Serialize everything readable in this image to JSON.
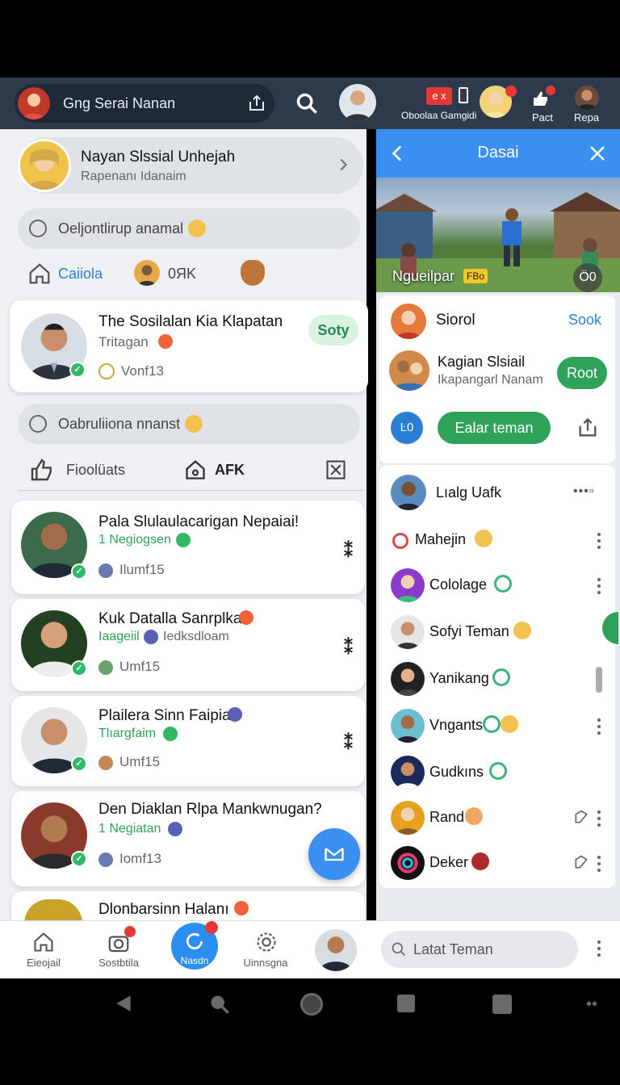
{
  "topbar": {
    "search_text": "Gng Serai Nanan",
    "group_label": "Oboolaa Gamgidi",
    "pact_label": "Pact",
    "repa_label": "Repa",
    "ex_badge": "e x"
  },
  "profile": {
    "name": "Nayan Slssial Unhejah",
    "sub": "Rapenanı Idanaim"
  },
  "composer1": {
    "placeholder": "Oeljontlirup anamal"
  },
  "quick": {
    "item1": "Caiiola",
    "item2": "0ЯK"
  },
  "featured": {
    "title": "The Sosilalan Kia Klapatan",
    "sub": "Tritagan",
    "meta": "Vonf13",
    "button": "Soty"
  },
  "composer2": {
    "placeholder": "Oabruliiona nnanst"
  },
  "actions": {
    "item1": "Fioolüats",
    "item2": "AFK"
  },
  "posts": [
    {
      "title": "Pala Slulaulacarigan Nepaiai!",
      "tag": "1 Negiogsen",
      "meta": "Ilumf15"
    },
    {
      "title": "Kuk Datalla Sanrplkan",
      "tag": "Iaageiil",
      "tag2": "Iedksdloam",
      "meta": "Umf15"
    },
    {
      "title": "Plailera Sinn Faipiaı",
      "tag": "Tlıargfaim",
      "meta": "Umf15"
    },
    {
      "title": "Den Diaklan Rlpa Mankwnugan?",
      "tag": "1 Negiatan",
      "meta": "Iomf13"
    },
    {
      "title": "Dlonbarsinn Halanı",
      "tag": "",
      "meta": ""
    }
  ],
  "panel": {
    "title": "Dasai",
    "image_caption": "Ngueilpar",
    "caption_badge": "FBo",
    "image_badge": "Ö0",
    "item1": {
      "name": "Siorol",
      "action": "Sook"
    },
    "item2": {
      "name": "Kagian Slsiail",
      "sub": "Ikapangarl Nanam",
      "action": "Root"
    },
    "left_chip": "Ŀ0",
    "main_button": "Ealar teman"
  },
  "friends": [
    {
      "name": "Lıalg Uafk"
    },
    {
      "name": "Mahejin"
    },
    {
      "name": "Cololage"
    },
    {
      "name": "Sofyi Teman"
    },
    {
      "name": "Yanikang"
    },
    {
      "name": "Vngants"
    },
    {
      "name": "Gudkıns"
    },
    {
      "name": "Rand"
    },
    {
      "name": "Deker"
    }
  ],
  "bottom_nav": {
    "home": "Eieojail",
    "notif": "Sostbtila",
    "center": "Nasdn",
    "settings": "Uinnsgna",
    "search_placeholder": "Latat Teman"
  },
  "colors": {
    "accent": "#3b8ff0",
    "green": "#2fa25a",
    "topbar": "#2c3a4c"
  }
}
